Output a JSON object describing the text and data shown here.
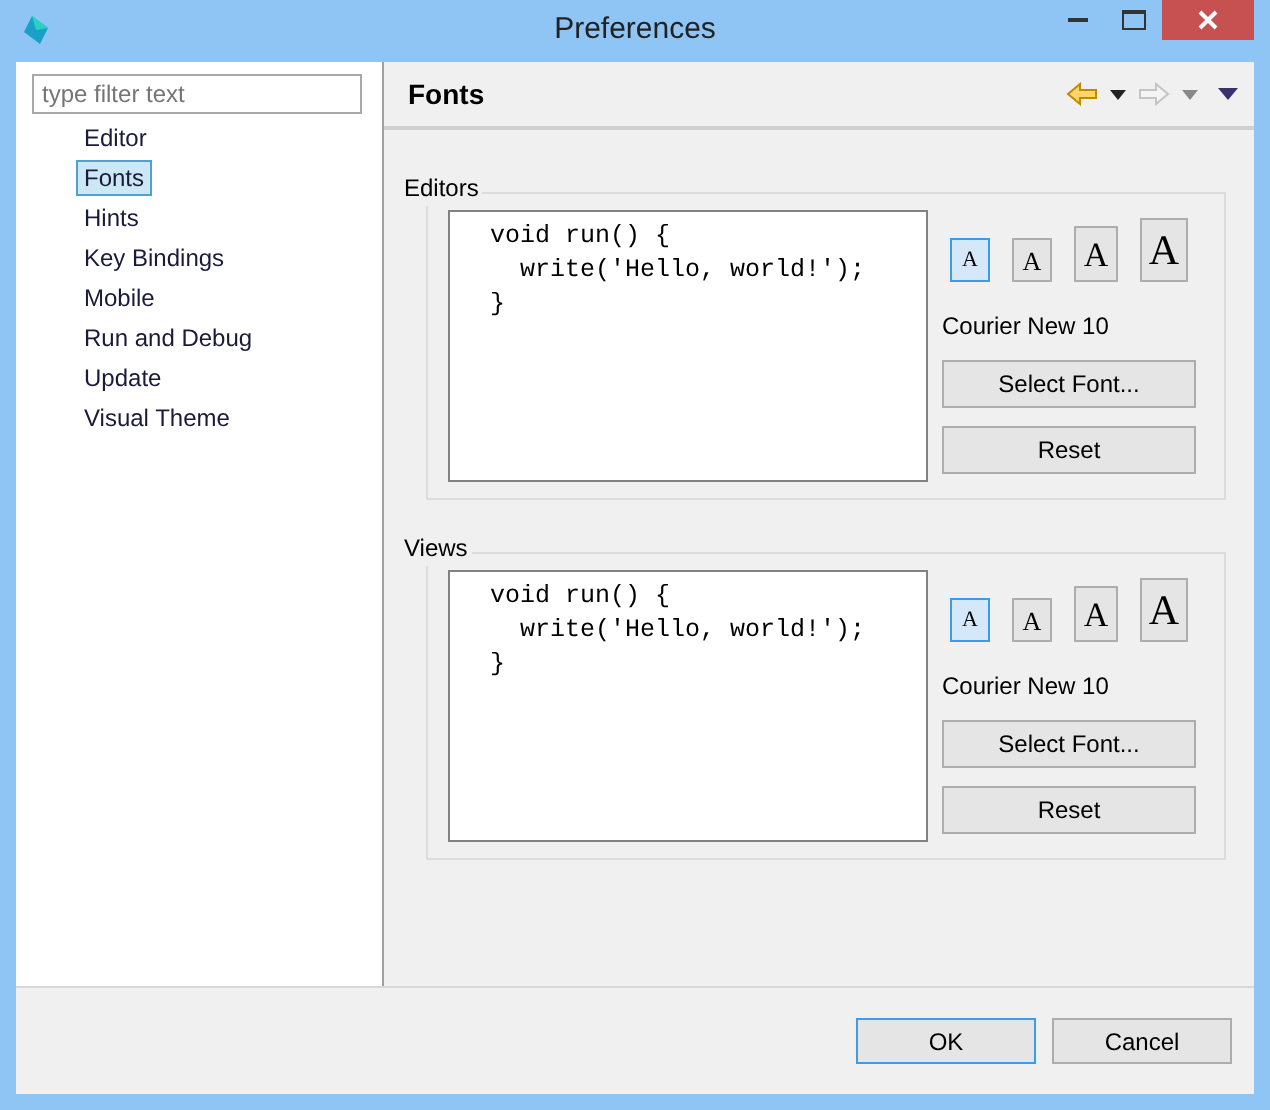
{
  "window": {
    "title": "Preferences"
  },
  "filter": {
    "placeholder": "type filter text"
  },
  "tree": [
    {
      "label": "Editor",
      "selected": false
    },
    {
      "label": "Fonts",
      "selected": true
    },
    {
      "label": "Hints",
      "selected": false
    },
    {
      "label": "Key Bindings",
      "selected": false
    },
    {
      "label": "Mobile",
      "selected": false
    },
    {
      "label": "Run and Debug",
      "selected": false
    },
    {
      "label": "Update",
      "selected": false
    },
    {
      "label": "Visual Theme",
      "selected": false
    }
  ],
  "page": {
    "title": "Fonts",
    "back": {
      "disabled": false
    },
    "forward": {
      "disabled": true
    }
  },
  "groups": [
    {
      "title": "Editors",
      "code": [
        "void run() {",
        "  write('Hello, world!');",
        "}"
      ],
      "sizes": [
        {
          "label": "A",
          "selected": true
        },
        {
          "label": "A",
          "selected": false
        },
        {
          "label": "A",
          "selected": false
        },
        {
          "label": "A",
          "selected": false
        }
      ],
      "font": "Courier New 10",
      "buttons": [
        "Select Font...",
        "Reset"
      ]
    },
    {
      "title": "Views",
      "code": [
        "void run() {",
        "  write('Hello, world!');",
        "}"
      ],
      "sizes": [
        {
          "label": "A",
          "selected": true
        },
        {
          "label": "A",
          "selected": false
        },
        {
          "label": "A",
          "selected": false
        },
        {
          "label": "A",
          "selected": false
        }
      ],
      "font": "Courier New 10",
      "buttons": [
        "Select Font...",
        "Reset"
      ]
    }
  ],
  "buttons": [
    "OK",
    "Cancel"
  ]
}
